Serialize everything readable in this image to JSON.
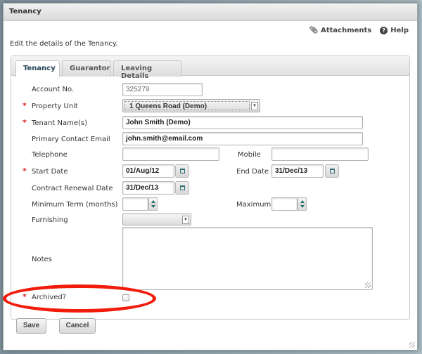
{
  "dialog": {
    "title": "Tenancy",
    "description": "Edit the details of the Tenancy.",
    "links": {
      "attachments": "Attachments",
      "help": "Help"
    }
  },
  "tabs": [
    {
      "label": "Tenancy",
      "active": true
    },
    {
      "label": "Guarantor",
      "active": false
    },
    {
      "label": "Leaving Details",
      "active": false
    }
  ],
  "form": {
    "account_no": {
      "label": "Account No.",
      "value": "325279"
    },
    "property_unit": {
      "label": "Property Unit",
      "value": "1 Queens Road (Demo)",
      "required": true
    },
    "tenant_names": {
      "label": "Tenant Name(s)",
      "value": "John Smith (Demo)",
      "required": true
    },
    "primary_email": {
      "label": "Primary Contact Email",
      "value": "john.smith@email.com"
    },
    "telephone": {
      "label": "Telephone",
      "value": ""
    },
    "mobile": {
      "label": "Mobile",
      "value": ""
    },
    "start_date": {
      "label": "Start Date",
      "value": "01/Aug/12",
      "required": true
    },
    "end_date": {
      "label": "End Date",
      "value": "31/Dec/13"
    },
    "contract_renewal_date": {
      "label": "Contract Renewal Date",
      "value": "31/Dec/13"
    },
    "minimum_term": {
      "label": "Minimum Term (months)",
      "value": ""
    },
    "maximum": {
      "label": "Maximum",
      "value": ""
    },
    "furnishing": {
      "label": "Furnishing",
      "value": ""
    },
    "notes": {
      "label": "Notes",
      "value": ""
    },
    "archived": {
      "label": "Archived?",
      "checked": false,
      "required": true
    },
    "required_marker": "*"
  },
  "buttons": {
    "save": "Save",
    "cancel": "Cancel"
  },
  "annotation": {
    "color": "#f21c0c",
    "target": "archived"
  }
}
